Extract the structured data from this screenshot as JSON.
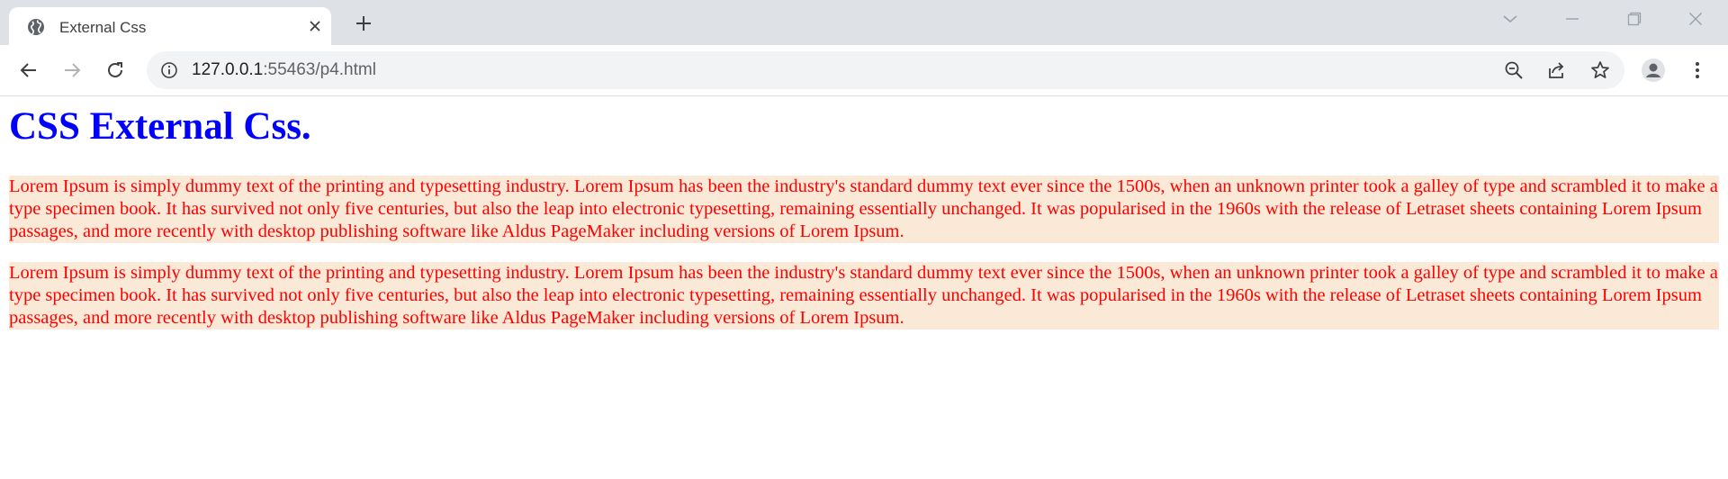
{
  "browser": {
    "tab": {
      "title": "External Css",
      "favicon": "globe-icon"
    },
    "address": {
      "host": "127.0.0.1",
      "rest": ":55463/p4.html"
    },
    "icons": {
      "back": "arrow-left-icon",
      "forward": "arrow-right-icon",
      "reload": "reload-icon",
      "site_info": "info-icon",
      "zoom": "zoom-out-icon",
      "share": "share-icon",
      "bookmark": "star-icon",
      "profile": "avatar-icon",
      "menu": "kebab-menu-icon"
    },
    "colors": {
      "tabstrip": "#dee1e6",
      "omnibox": "#f1f3f4"
    }
  },
  "page": {
    "heading": "CSS External Css.",
    "paragraphs": [
      "Lorem Ipsum is simply dummy text of the printing and typesetting industry. Lorem Ipsum has been the industry's standard dummy text ever since the 1500s, when an unknown printer took a galley of type and scrambled it to make a type specimen book. It has survived not only five centuries, but also the leap into electronic typesetting, remaining essentially unchanged. It was popularised in the 1960s with the release of Letraset sheets containing Lorem Ipsum passages, and more recently with desktop publishing software like Aldus PageMaker including versions of Lorem Ipsum.",
      "Lorem Ipsum is simply dummy text of the printing and typesetting industry. Lorem Ipsum has been the industry's standard dummy text ever since the 1500s, when an unknown printer took a galley of type and scrambled it to make a type specimen book. It has survived not only five centuries, but also the leap into electronic typesetting, remaining essentially unchanged. It was popularised in the 1960s with the release of Letraset sheets containing Lorem Ipsum passages, and more recently with desktop publishing software like Aldus PageMaker including versions of Lorem Ipsum."
    ],
    "colors": {
      "heading": "#0000ff",
      "paragraph_text": "#ff0000",
      "paragraph_background": "#fbe9d7"
    }
  }
}
